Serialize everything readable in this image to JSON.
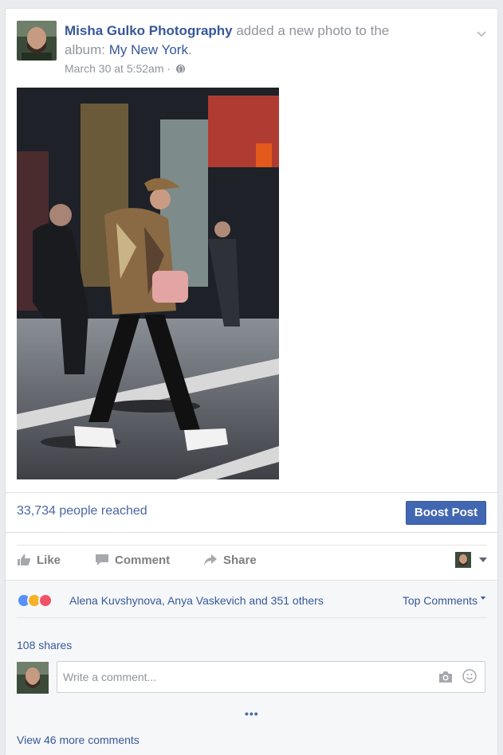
{
  "post": {
    "author": "Misha Gulko Photography",
    "action_text": " added a new photo to the album: ",
    "album": "My New York",
    "album_suffix": ".",
    "timestamp": "March 30 at 5:52am",
    "separator": " · ",
    "privacy_icon": "globe-icon",
    "menu_icon": "chevron-down-icon"
  },
  "stats": {
    "reach": "33,734 people reached",
    "boost_label": "Boost Post"
  },
  "actions": {
    "like": "Like",
    "comment": "Comment",
    "share": "Share"
  },
  "reactions": {
    "icons": [
      "like-reaction-icon",
      "haha-reaction-icon",
      "love-reaction-icon"
    ],
    "likers": "Alena Kuvshynova, Anya Vaskevich and 351 others",
    "sort_label": "Top Comments",
    "shares": "108 shares"
  },
  "comment_box": {
    "placeholder": "Write a comment...",
    "more_indicator": "•••",
    "view_more": "View 46 more comments"
  },
  "colors": {
    "link_blue": "#365899",
    "button_blue": "#4267b2",
    "muted_gray": "#90949c",
    "like_blue": "#5890ff",
    "haha_yellow": "#f7b125",
    "love_red": "#f25268"
  }
}
